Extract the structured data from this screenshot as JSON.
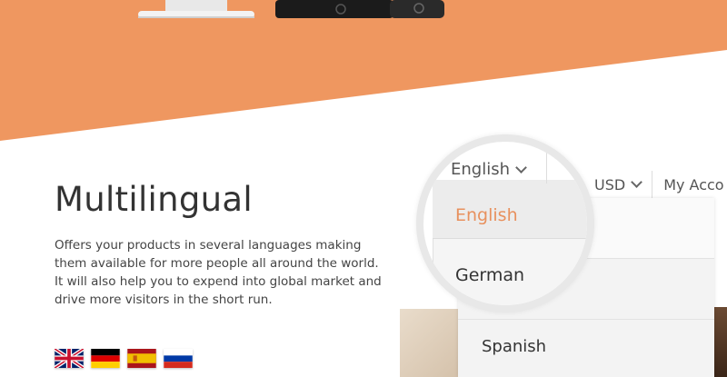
{
  "colors": {
    "hero": "#ef9760",
    "accent": "#e8915e"
  },
  "section": {
    "title": "Multilingual",
    "description": "Offers your products in several languages making them available for more people all around the world. It will also help you to expend into global market and drive more visitors in the short run."
  },
  "flags": [
    "uk-flag-icon",
    "germany-flag-icon",
    "spain-flag-icon",
    "russia-flag-icon"
  ],
  "header": {
    "language_selected": "English",
    "currency": "USD",
    "account": "My Acco"
  },
  "language_menu": {
    "items": [
      "English",
      "German",
      "Spanish"
    ]
  }
}
